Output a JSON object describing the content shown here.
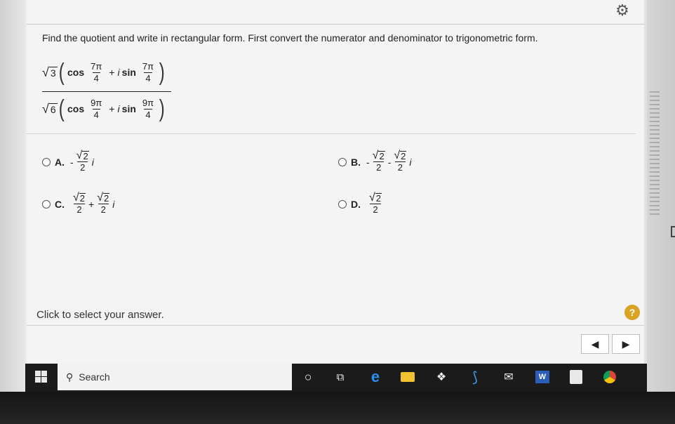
{
  "prompt": "Find the quotient and write in rectangular form. First convert the numerator and denominator to trigonometric form.",
  "expression": {
    "numerator": {
      "coef": "3",
      "cos_num": "7π",
      "cos_den": "4",
      "sin_num": "7π",
      "sin_den": "4",
      "cos": "cos",
      "sin": "sin",
      "plus": "+",
      "i": "i"
    },
    "denominator": {
      "coef": "6",
      "cos_num": "9π",
      "cos_den": "4",
      "sin_num": "9π",
      "sin_den": "4",
      "cos": "cos",
      "sin": "sin",
      "plus": "+",
      "i": "i"
    }
  },
  "choices": [
    {
      "label": "A.",
      "sign": "-",
      "rad": "2",
      "den": "2",
      "i": "i"
    },
    {
      "label": "B.",
      "sign1": "-",
      "rad1": "2",
      "den1": "2",
      "sign2": "-",
      "rad2": "2",
      "den2": "2",
      "i": "i"
    },
    {
      "label": "C.",
      "rad1": "2",
      "den1": "2",
      "plus": "+",
      "rad2": "2",
      "den2": "2",
      "i": "i"
    },
    {
      "label": "D.",
      "rad": "2",
      "den": "2"
    }
  ],
  "footer": {
    "click_text": "Click to select your answer.",
    "help": "?"
  },
  "nav": {
    "prev": "◀",
    "next": "▶"
  },
  "taskbar": {
    "search_placeholder": "Search"
  },
  "symbols": {
    "sqrt": "√",
    "gear": "⚙"
  },
  "colors": {
    "help_badge": "#d8a422",
    "taskbar": "#1b1b1b"
  },
  "icons": [
    "windows-icon",
    "search-icon",
    "cortana-icon",
    "task-view-icon",
    "edge-icon",
    "file-explorer-icon",
    "dropbox-icon",
    "visual-studio-icon",
    "mail-icon",
    "word-icon",
    "paint-icon",
    "chrome-icon"
  ]
}
